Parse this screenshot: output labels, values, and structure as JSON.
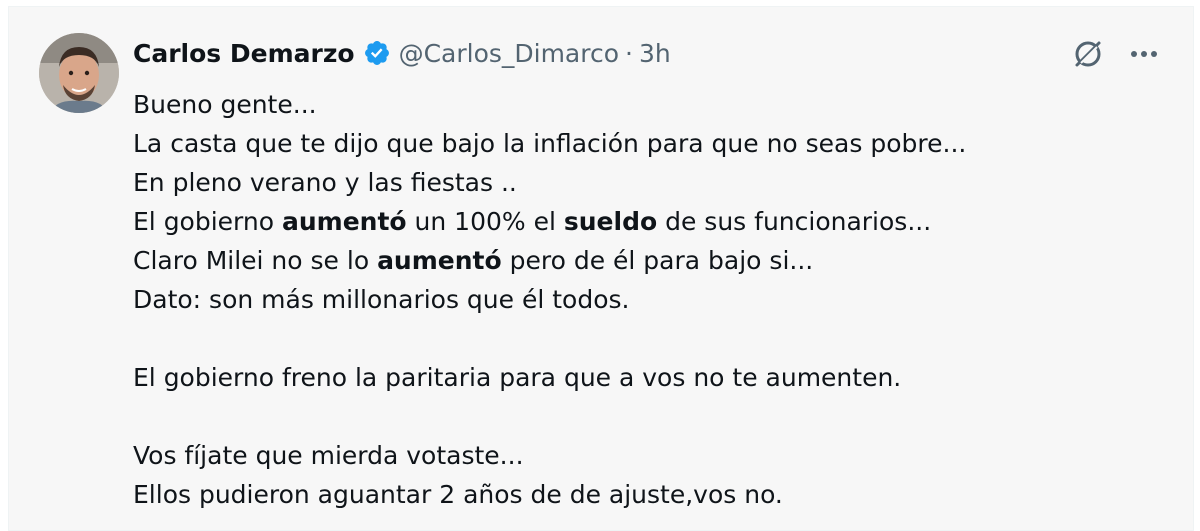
{
  "author": {
    "name": "Carlos Demarzo",
    "handle": "@Carlos_Dimarco",
    "separator": "·",
    "time": "3h"
  },
  "icons": {
    "verified": "verified-badge-icon",
    "grok": "grok-icon",
    "more": "more-options-icon",
    "avatar": "avatar",
    "verified_color": "#1d9bf0"
  },
  "tweet": {
    "l1": "Bueno gente...",
    "l2": "La casta que te dijo que bajo la inflación para que no seas pobre...",
    "l3": "En pleno verano y las fiestas ..",
    "l4_a": "El gobierno ",
    "l4_b": "aumentó",
    "l4_c": " un 100% el ",
    "l4_d": "sueldo",
    "l4_e": " de sus funcionarios...",
    "l5_a": "Claro Milei no se lo ",
    "l5_b": "aumentó",
    "l5_c": " pero de él para bajo si...",
    "l6": "Dato: son más millonarios que él todos.",
    "l7": "El gobierno freno la paritaria para que a vos no te aumenten.",
    "l8": "Vos fíjate que mierda votaste...",
    "l9": "Ellos pudieron aguantar 2 años de de ajuste,vos no."
  }
}
